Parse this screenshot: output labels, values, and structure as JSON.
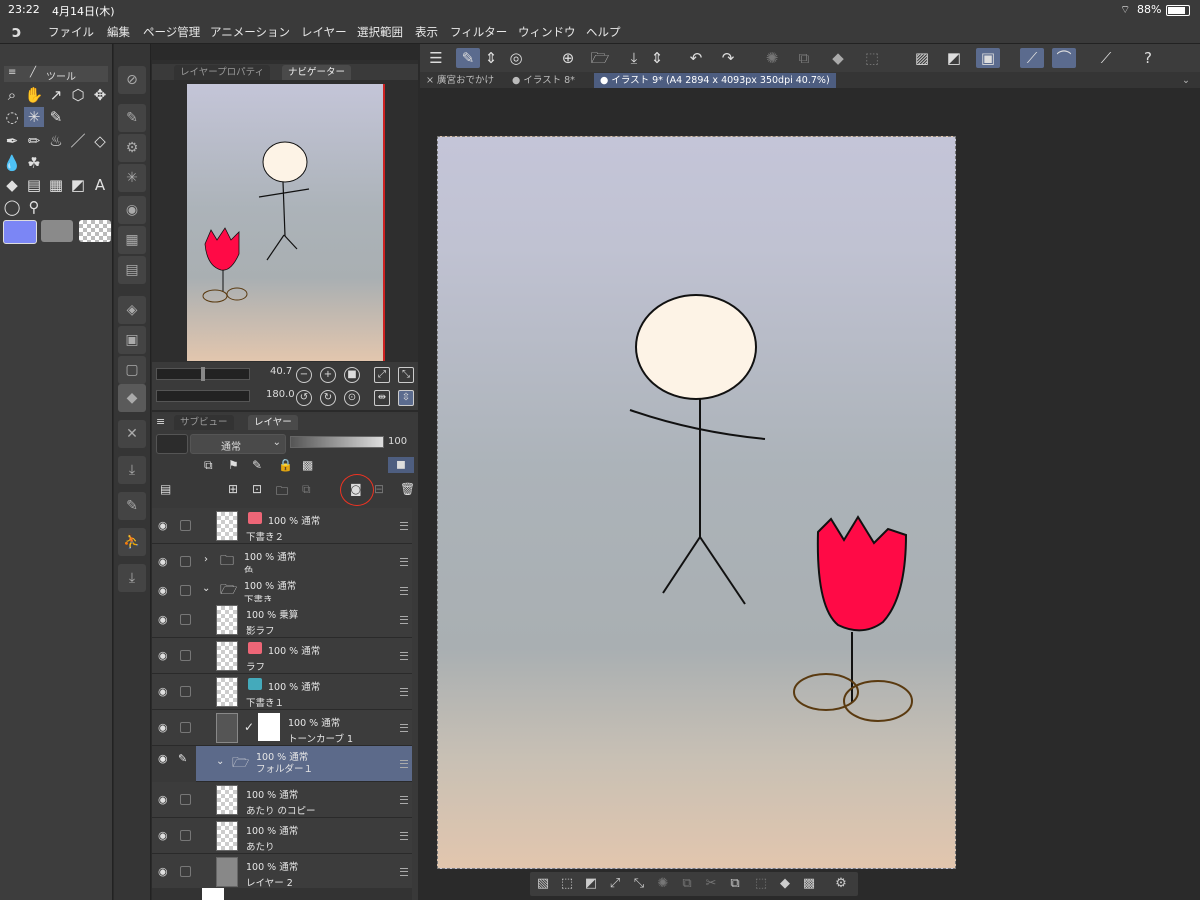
{
  "status": {
    "time": "23:22",
    "date": "4月14日(木)",
    "battery": "88%"
  },
  "menu": [
    "ファイル",
    "編集",
    "ページ管理",
    "アニメーション",
    "レイヤー",
    "選択範囲",
    "表示",
    "フィルター",
    "ウィンドウ",
    "ヘルプ"
  ],
  "tool_panel": {
    "tab": "ツール"
  },
  "navigator": {
    "tab_props": "レイヤープロパティ",
    "tab_nav": "ナビゲーター",
    "zoom": "40.7",
    "rotation": "180.0"
  },
  "layer_panel": {
    "tab_sub": "サブビュー",
    "tab_layer": "レイヤー",
    "blend_mode": "通常",
    "opacity": "100",
    "layers": [
      {
        "line1": "100 % 通常",
        "line2": "下書き２"
      },
      {
        "line1": "100 % 通常",
        "line2": "色"
      },
      {
        "line1": "100 % 通常",
        "line2": "下書き"
      },
      {
        "line1": "100 % 乗算",
        "line2": "影ラフ"
      },
      {
        "line1": "100 % 通常",
        "line2": "ラフ"
      },
      {
        "line1": "100 % 通常",
        "line2": "下書き１"
      },
      {
        "line1": "100 % 通常",
        "line2": "トーンカーブ 1"
      },
      {
        "line1": "100 % 通常",
        "line2": "フォルダー１"
      },
      {
        "line1": "100 % 通常",
        "line2": "あたり のコピー"
      },
      {
        "line1": "100 % 通常",
        "line2": "あたり"
      },
      {
        "line1": "100 % 通常",
        "line2": "レイヤー 2"
      }
    ]
  },
  "doc_tabs": [
    "廣宮おでかけ",
    "イラスト 8*",
    "イラスト 9* (A4 2894 x 4093px 350dpi 40.7%)"
  ],
  "colors": {
    "main_color": "#7b86f5",
    "sub_color": "#8a8a8a",
    "tulip": "#ff0a46",
    "face": "#fdf3e6",
    "selected_layer": "#5c6a8a",
    "accent": "#5b6b8e"
  }
}
